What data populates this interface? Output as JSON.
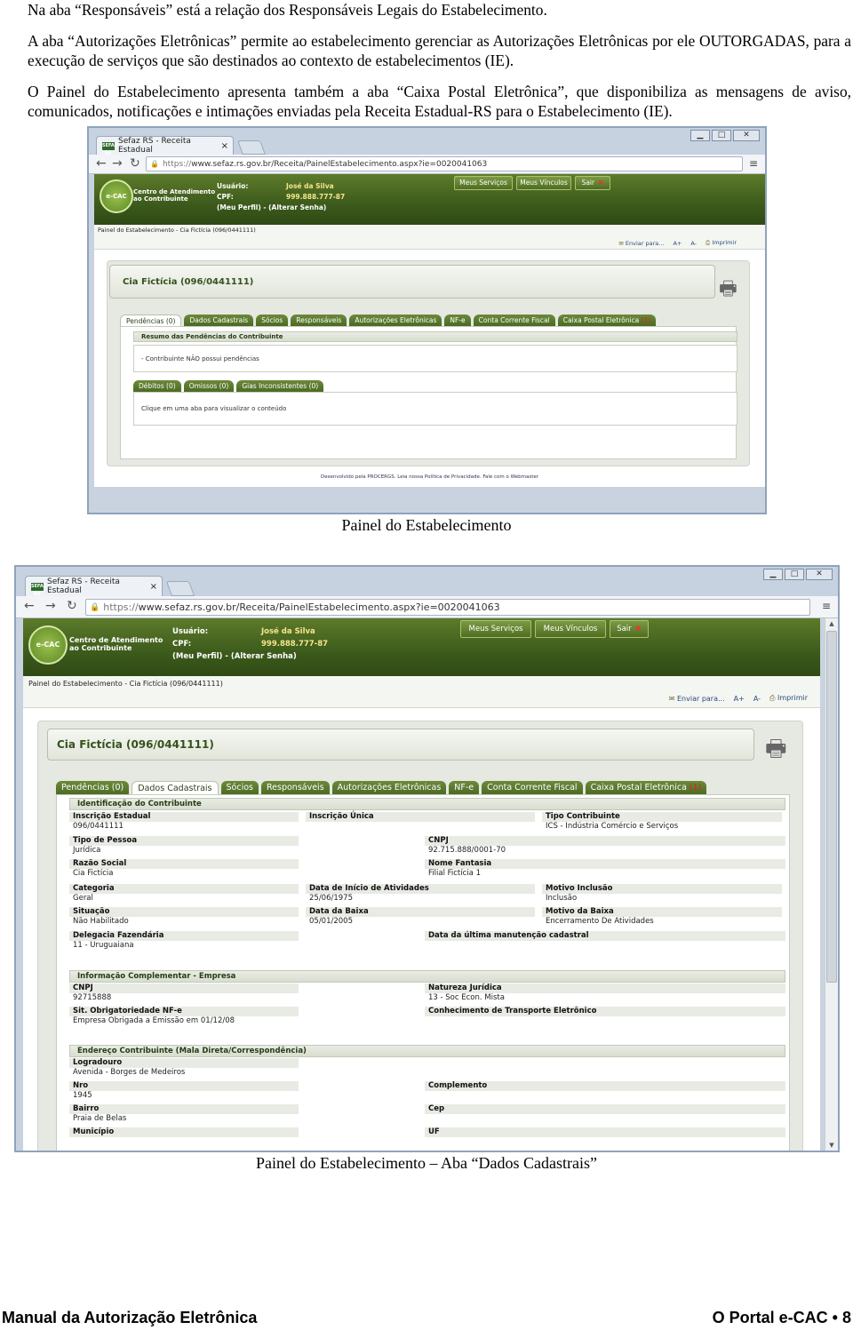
{
  "paragraphs": {
    "p1": "Na aba “Responsáveis” está a relação dos Responsáveis Legais do Estabelecimento.",
    "p2": "A aba “Autorizações Eletrônicas” permite ao estabelecimento gerenciar as Autorizações Eletrônicas por ele OUTORGADAS, para a execução de serviços que são destinados ao contexto de estabelecimentos (IE).",
    "p3": "O Painel do Estabelecimento apresenta também a aba “Caixa Postal Eletrônica”, que disponibiliza as mensagens de aviso, comunicados, notificações e intimações enviadas pela Receita Estadual-RS para o Estabelecimento (IE)."
  },
  "captions": {
    "fig1": "Painel do Estabelecimento",
    "fig2": "Painel do Estabelecimento – Aba “Dados Cadastrais”"
  },
  "browser": {
    "tab_title": "Sefaz RS - Receita Estadual",
    "favicon_text": "SEFAZ RS",
    "url_scheme": "https://",
    "url_rest": "www.sefaz.rs.gov.br/Receita/PainelEstabelecimento.aspx?ie=0020041063",
    "tab_close": "×",
    "ctrl_min": "▁",
    "ctrl_max": "□",
    "ctrl_close": "✕",
    "back": "←",
    "forward": "→",
    "reload": "↻",
    "menu": "≡"
  },
  "site": {
    "logo_short": "e-CAC",
    "logo_line1": "Centro de Atendimento",
    "logo_line2": "ao Contribuinte",
    "user_label": "Usuário:",
    "user_value": "José da Silva",
    "cpf_label": "CPF:",
    "cpf_value": "999.888.777-87",
    "profile_links": "(Meu Perfil) - (Alterar Senha)",
    "btn_services": "Meus Serviços",
    "btn_links": "Meus Vínculos",
    "btn_exit": "Sair",
    "btn_exit_x": "✖",
    "breadcrumb": "Painel do Estabelecimento - Cia Fictícia (096/0441111)",
    "action_send": "Enviar para...",
    "action_zoom_in": "A+",
    "action_zoom_out": "A-",
    "action_print": "Imprimir",
    "company_title": "Cia Fictícia (096/0441111)",
    "footer": "Desenvolvido pela PROCERGS. Leia nossa Política de Privacidade. Fale com o Webmaster"
  },
  "tabs": [
    {
      "label": "Pendências (0)",
      "count": ""
    },
    {
      "label": "Dados Cadastrais",
      "count": ""
    },
    {
      "label": "Sócios",
      "count": ""
    },
    {
      "label": "Responsáveis",
      "count": ""
    },
    {
      "label": "Autorizações Eletrônicas",
      "count": ""
    },
    {
      "label": "NF-e",
      "count": ""
    },
    {
      "label": "Conta Corrente Fiscal",
      "count": ""
    },
    {
      "label": "Caixa Postal Eletrônica",
      "count": " (1)"
    }
  ],
  "fig1": {
    "pend_header": "Resumo das Pendências do Contribuinte",
    "pend_text": "- Contribuinte NÃO possui pendências",
    "subtabs": [
      "Débitos (0)",
      "Omissos (0)",
      "Gias Inconsistentes (0)"
    ],
    "subtab_hint": "Clique em uma aba para visualizar o conteúdo"
  },
  "fig2": {
    "sec1": "Identificação do Contribuinte",
    "sec2": "Informação Complementar - Empresa",
    "sec3": "Endereço Contribuinte (Mala Direta/Correspondência)",
    "fields": {
      "ie_l": "Inscrição Estadual",
      "ie_v": "096/0441111",
      "iu_l": "Inscrição Única",
      "tc_l": "Tipo Contribuinte",
      "tc_v": "ICS - Indústria Comércio e Serviços",
      "tp_l": "Tipo de Pessoa",
      "tp_v": "Jurídica",
      "cnpj_l": "CNPJ",
      "cnpj_v": "92.715.888/0001-70",
      "rs_l": "Razão Social",
      "rs_v": "Cia Fictícia",
      "nf_l": "Nome Fantasia",
      "nf_v": "Filial Fictícia 1",
      "cat_l": "Categoria",
      "cat_v": "Geral",
      "dia_l": "Data de Início de Atividades",
      "dia_v": "25/06/1975",
      "mi_l": "Motivo Inclusão",
      "mi_v": "Inclusão",
      "sit_l": "Situação",
      "sit_v": "Não Habilitado",
      "db_l": "Data da Baixa",
      "db_v": "05/01/2005",
      "mb_l": "Motivo da Baixa",
      "mb_v": "Encerramento De Atividades",
      "df_l": "Delegacia Fazendária",
      "df_v": "11 - Uruguaiana",
      "dum_l": "Data da última manutenção cadastral",
      "c2_l": "CNPJ",
      "c2_v": "92715888",
      "nj_l": "Natureza Jurídica",
      "nj_v": "13 - Soc Econ. Mista",
      "so_l": "Sit. Obrigatoriedade NF-e",
      "so_v": "Empresa Obrigada a Emissão em 01/12/08",
      "ct_l": "Conhecimento de Transporte Eletrônico",
      "lg_l": "Logradouro",
      "lg_v": "Avenida - Borges de Medeiros",
      "nro_l": "Nro",
      "nro_v": "1945",
      "comp_l": "Complemento",
      "bai_l": "Bairro",
      "bai_v": "Praia de Belas",
      "cep_l": "Cep",
      "mun_l": "Município",
      "uf_l": "UF"
    }
  },
  "footer": {
    "left": "Manual da Autorização Eletrônica",
    "right": "O Portal e-CAC • 8"
  }
}
